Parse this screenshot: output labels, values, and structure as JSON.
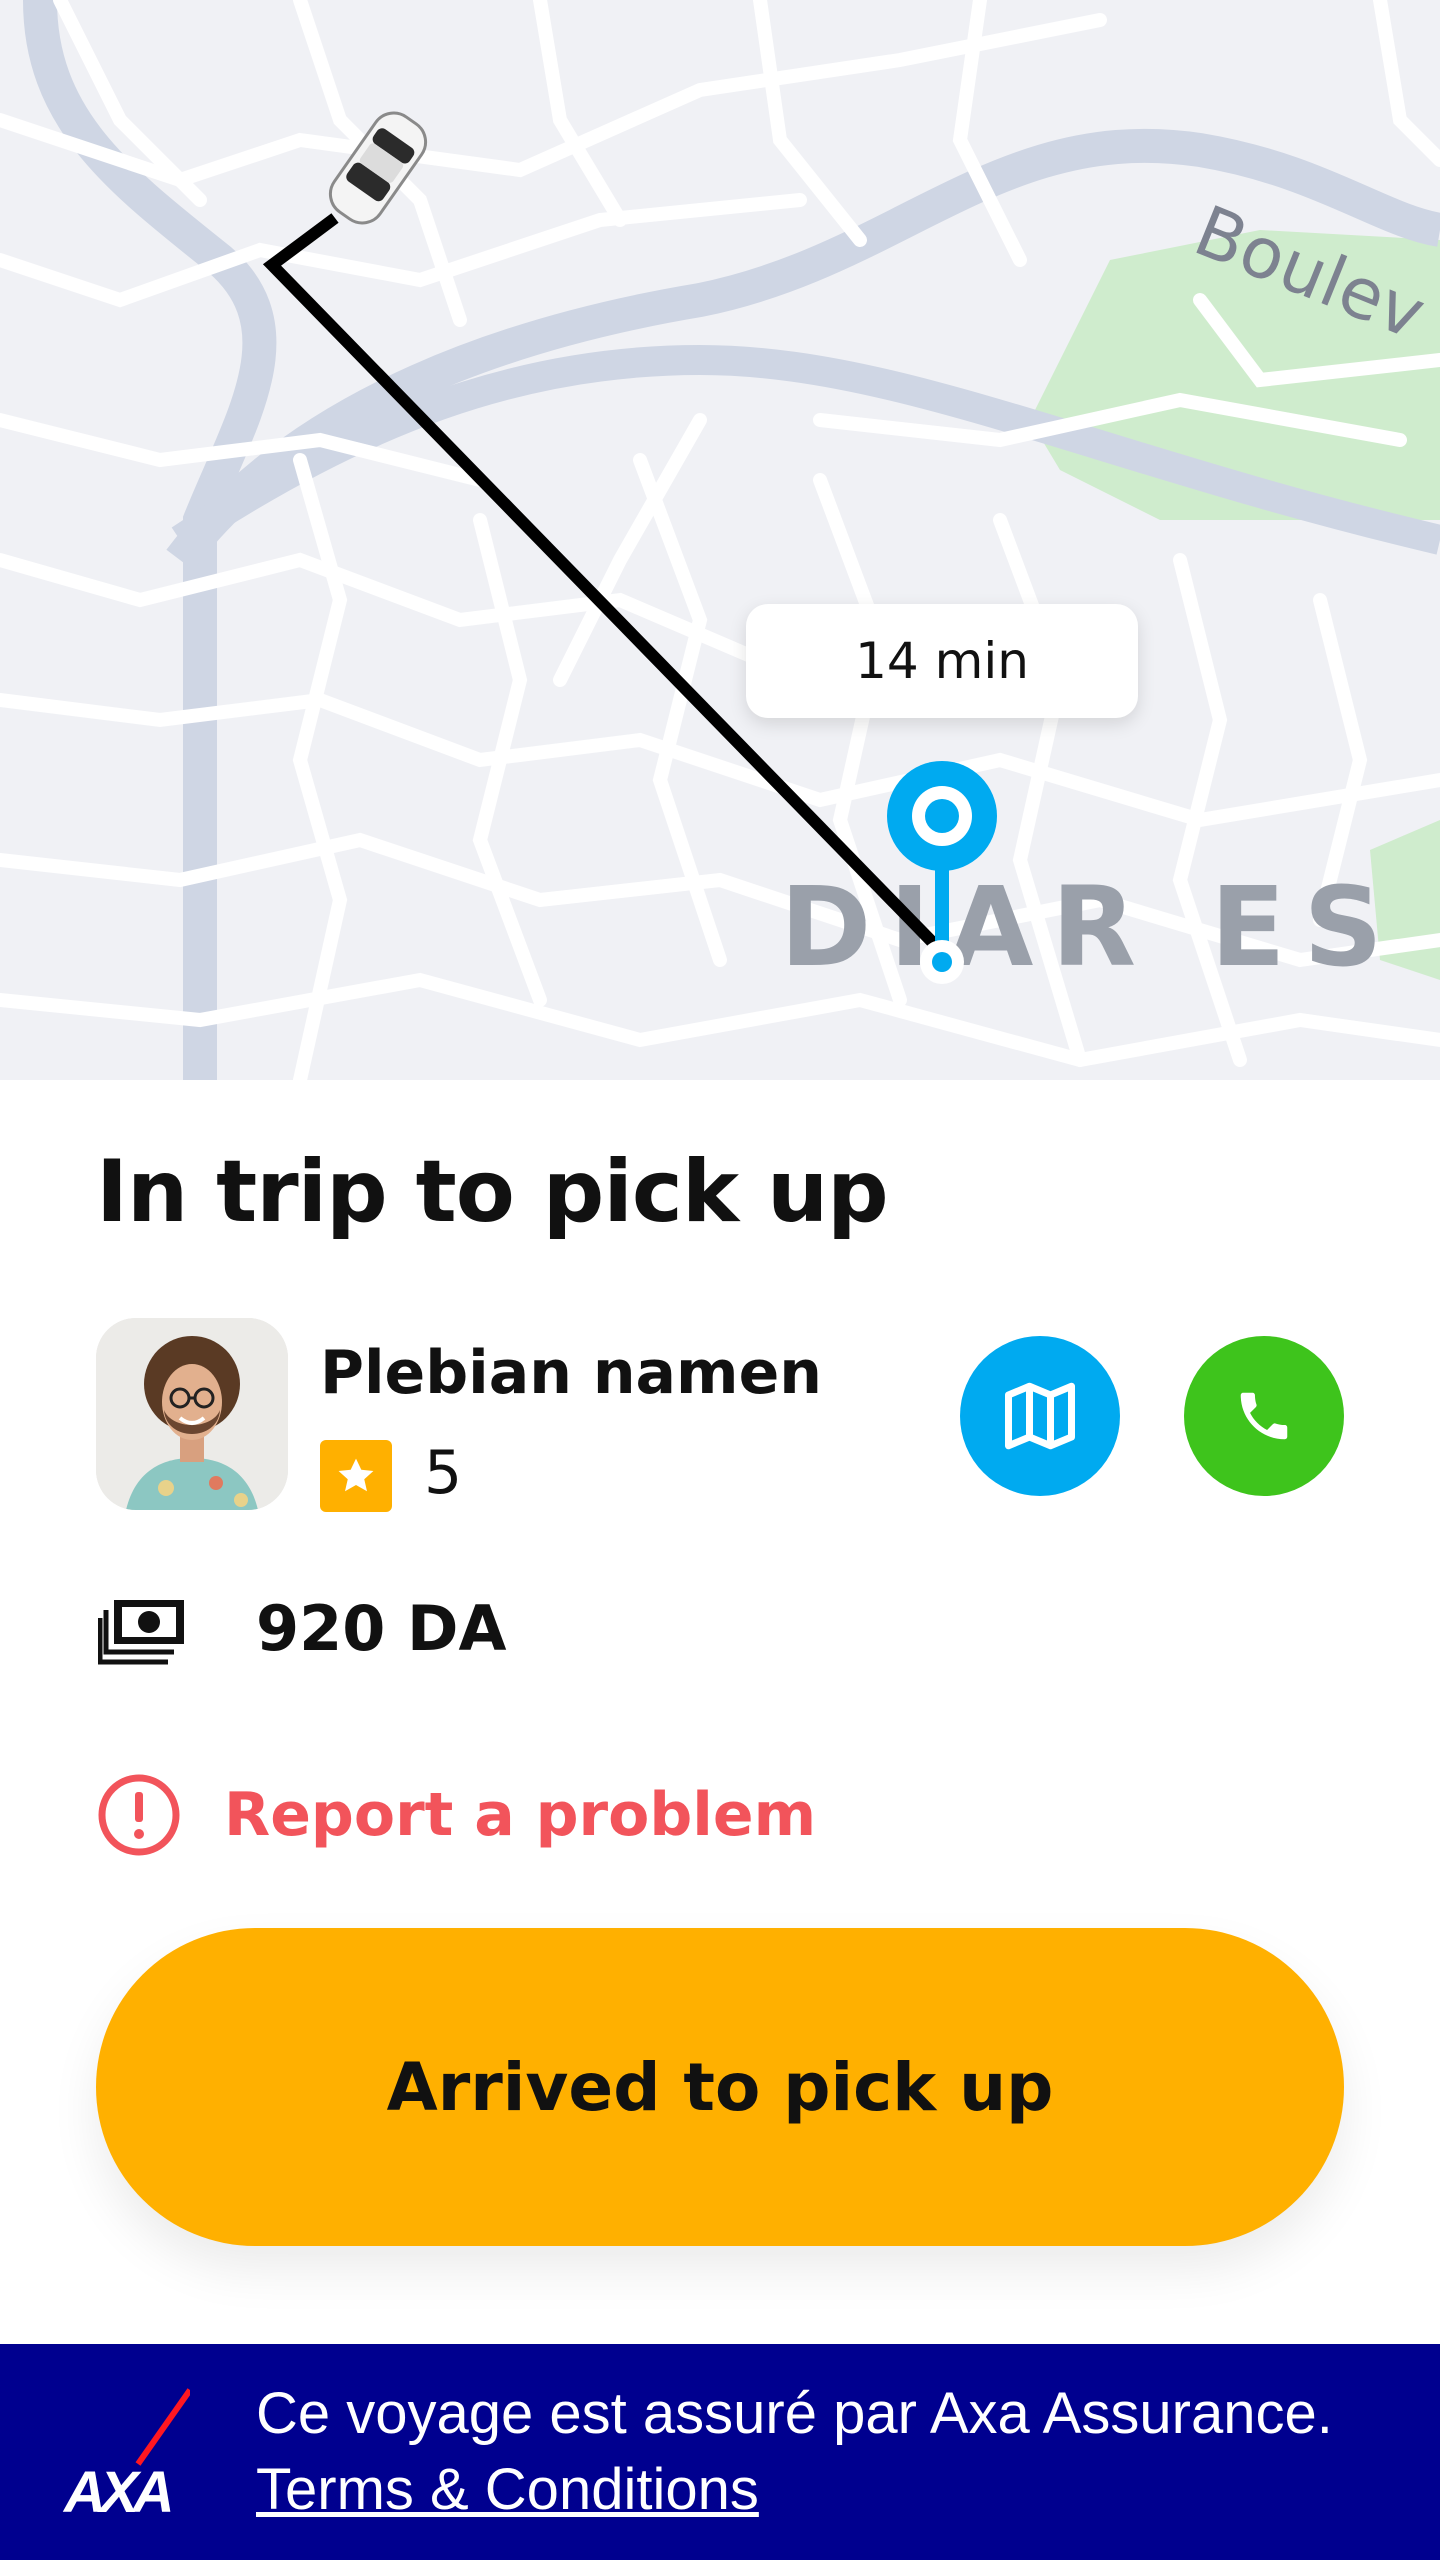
{
  "map": {
    "eta_label": "14 min",
    "street_label": "Boulev",
    "district_label": "DIAR ES S"
  },
  "trip": {
    "status_title": "In trip to pick up",
    "driver": {
      "name": "Plebian namen",
      "rating": "5"
    },
    "price": "920 DA",
    "report_label": "Report a problem",
    "primary_action_label": "Arrived to pick up"
  },
  "insurance": {
    "text": "Ce voyage est assuré par Axa Assurance.",
    "link_label": "Terms & Conditions",
    "logo_text": "AXA"
  },
  "colors": {
    "accent_yellow": "#ffb000",
    "map_button_blue": "#00aaf0",
    "call_button_green": "#3ec41c",
    "report_red": "#f2545b",
    "insurance_navy": "#00008f"
  },
  "icons": {
    "map_button": "map-icon",
    "call_button": "phone-icon",
    "rating": "star-icon",
    "price": "cash-icon",
    "report": "alert-circle-icon",
    "car": "car-icon",
    "pickup": "location-pin-icon"
  }
}
